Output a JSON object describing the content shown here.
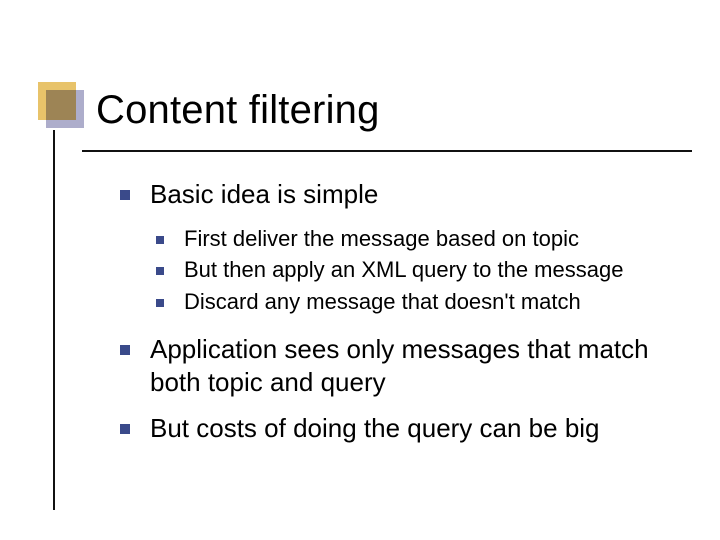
{
  "title": "Content filtering",
  "bullets": {
    "l1_0": "Basic idea is simple",
    "sub": {
      "s0": "First deliver the message based on topic",
      "s1": "But then apply an XML query to the message",
      "s2": "Discard any message that doesn't match"
    },
    "l1_1": "Application sees only messages that match both topic and query",
    "l1_2": "But costs of doing the query can be big"
  }
}
